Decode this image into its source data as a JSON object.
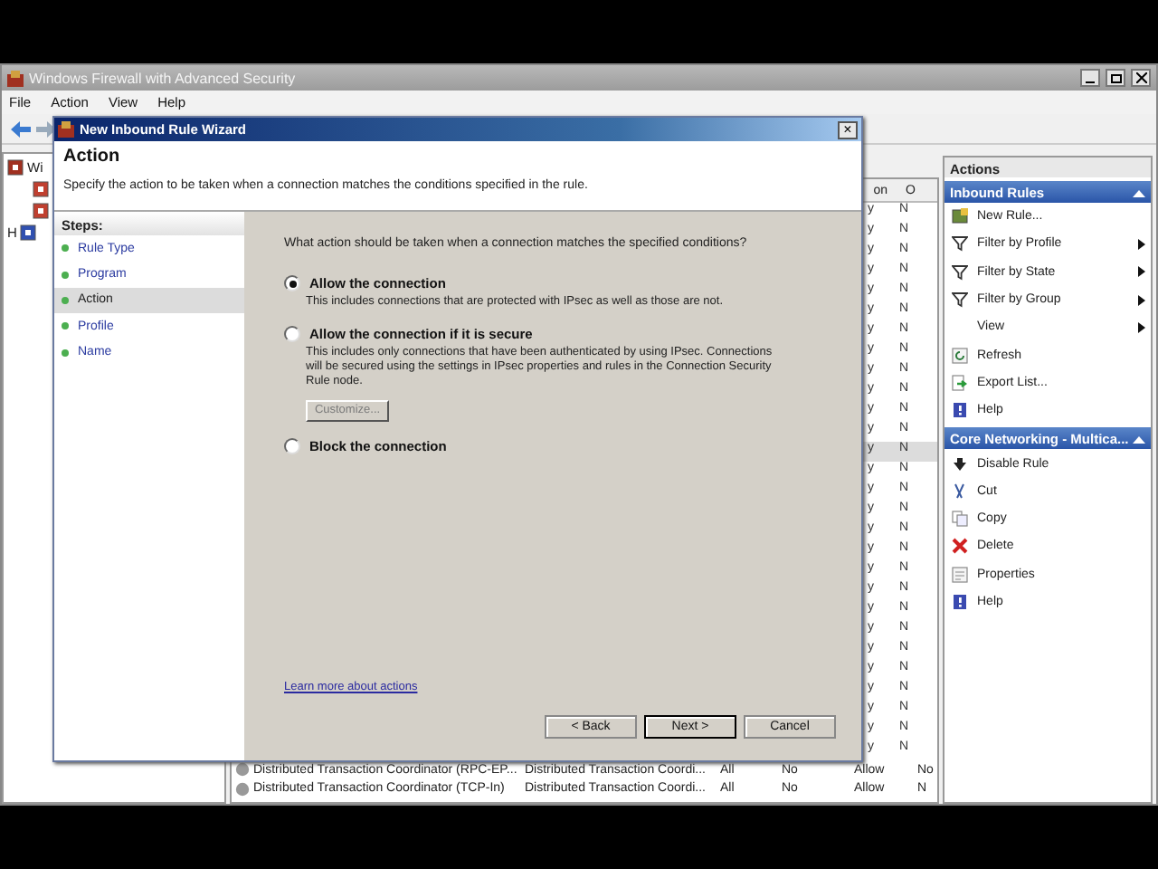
{
  "window": {
    "title": "Windows Firewall with Advanced Security"
  },
  "menu": [
    "File",
    "Action",
    "View",
    "Help"
  ],
  "tree": {
    "items": [
      {
        "label": "Wi"
      },
      {
        "label": "H"
      }
    ]
  },
  "table": {
    "header_fragments": [
      "on",
      "O"
    ],
    "fragment_rows": [
      {
        "column_1": "y",
        "column_2": "N",
        "selected": false
      },
      {
        "column_1": "y",
        "column_2": "N",
        "selected": false
      },
      {
        "column_1": "y",
        "column_2": "N",
        "selected": false
      },
      {
        "column_1": "y",
        "column_2": "N",
        "selected": false
      },
      {
        "column_1": "y",
        "column_2": "N",
        "selected": false
      },
      {
        "column_1": "y",
        "column_2": "N",
        "selected": false
      },
      {
        "column_1": "y",
        "column_2": "N",
        "selected": false
      },
      {
        "column_1": "y",
        "column_2": "N",
        "selected": false
      },
      {
        "column_1": "y",
        "column_2": "N",
        "selected": false
      },
      {
        "column_1": "y",
        "column_2": "N",
        "selected": false
      },
      {
        "column_1": "y",
        "column_2": "N",
        "selected": false
      },
      {
        "column_1": "y",
        "column_2": "N",
        "selected": false
      },
      {
        "column_1": "y",
        "column_2": "N",
        "selected": true
      },
      {
        "column_1": "y",
        "column_2": "N",
        "selected": false
      },
      {
        "column_1": "y",
        "column_2": "N",
        "selected": false
      },
      {
        "column_1": "y",
        "column_2": "N",
        "selected": false
      },
      {
        "column_1": "y",
        "column_2": "N",
        "selected": false
      },
      {
        "column_1": "y",
        "column_2": "N",
        "selected": false
      },
      {
        "column_1": "y",
        "column_2": "N",
        "selected": false
      },
      {
        "column_1": "y",
        "column_2": "N",
        "selected": false
      },
      {
        "column_1": "y",
        "column_2": "N",
        "selected": false
      },
      {
        "column_1": "y",
        "column_2": "N",
        "selected": false
      },
      {
        "column_1": "y",
        "column_2": "N",
        "selected": false
      },
      {
        "column_1": "y",
        "column_2": "N",
        "selected": false
      },
      {
        "column_1": "y",
        "column_2": "N",
        "selected": false
      },
      {
        "column_1": "y",
        "column_2": "N",
        "selected": false
      },
      {
        "column_1": "y",
        "column_2": "N",
        "selected": false
      },
      {
        "column_1": "y",
        "column_2": "N",
        "selected": false
      }
    ],
    "rows": [
      {
        "name": "Distributed Transaction Coordinator (RPC-EP...",
        "group": "Distributed Transaction Coordi...",
        "profile": "All",
        "enabled": "No",
        "action": "Allow",
        "override": "No"
      },
      {
        "name": "Distributed Transaction Coordinator (TCP-In)",
        "group": "Distributed Transaction Coordi...",
        "profile": "All",
        "enabled": "No",
        "action": "Allow",
        "override": "N"
      }
    ]
  },
  "actions": {
    "title": "Actions",
    "sections": [
      {
        "title": "Inbound Rules",
        "expanded": true,
        "items": [
          {
            "label": "New Rule...",
            "kind": "new-rule",
            "submenu": false
          },
          {
            "label": "Filter by Profile",
            "kind": "filter",
            "submenu": true
          },
          {
            "label": "Filter by State",
            "kind": "filter",
            "submenu": true
          },
          {
            "label": "Filter by Group",
            "kind": "filter",
            "submenu": true
          },
          {
            "label": "View",
            "kind": "blank",
            "submenu": true
          },
          {
            "label": "Refresh",
            "kind": "refresh",
            "submenu": false
          },
          {
            "label": "Export List...",
            "kind": "export",
            "submenu": false
          },
          {
            "label": "Help",
            "kind": "help",
            "submenu": false
          }
        ]
      },
      {
        "title": "Core Networking - Multica...",
        "expanded": true,
        "items": [
          {
            "label": "Disable Rule",
            "kind": "disable",
            "submenu": false
          },
          {
            "label": "Cut",
            "kind": "cut",
            "submenu": false
          },
          {
            "label": "Copy",
            "kind": "copy",
            "submenu": false
          },
          {
            "label": "Delete",
            "kind": "delete",
            "submenu": false
          },
          {
            "label": "Properties",
            "kind": "properties",
            "submenu": false
          },
          {
            "label": "Help",
            "kind": "help",
            "submenu": false
          }
        ]
      }
    ]
  },
  "wizard": {
    "title": "New Inbound Rule Wizard",
    "close": "×",
    "heading": "Action",
    "subtitle": "Specify the action to be taken when a connection matches the conditions specified in the rule.",
    "steps_title": "Steps:",
    "steps": [
      {
        "label": "Rule Type",
        "selected": false
      },
      {
        "label": "Program",
        "selected": false
      },
      {
        "label": "Action",
        "selected": true
      },
      {
        "label": "Profile",
        "selected": false
      },
      {
        "label": "Name",
        "selected": false
      }
    ],
    "question": "What action should be taken when a connection matches the specified conditions?",
    "options": [
      {
        "label": "Allow the connection",
        "description": "This includes connections that are protected with IPsec as well as those are not.",
        "selected": true
      },
      {
        "label": "Allow the connection if it is secure",
        "description": "This includes only connections that have been authenticated by using IPsec.  Connections will be secured using the settings in IPsec properties and rules in the Connection Security Rule node.",
        "selected": false,
        "button": {
          "label": "Customize...",
          "disabled": true
        }
      },
      {
        "label": "Block the connection",
        "selected": false
      }
    ],
    "link": "Learn more about actions",
    "buttons": [
      {
        "label": "< Back",
        "focused": false
      },
      {
        "label": "Next >",
        "focused": true
      },
      {
        "label": "Cancel",
        "focused": false
      }
    ]
  }
}
